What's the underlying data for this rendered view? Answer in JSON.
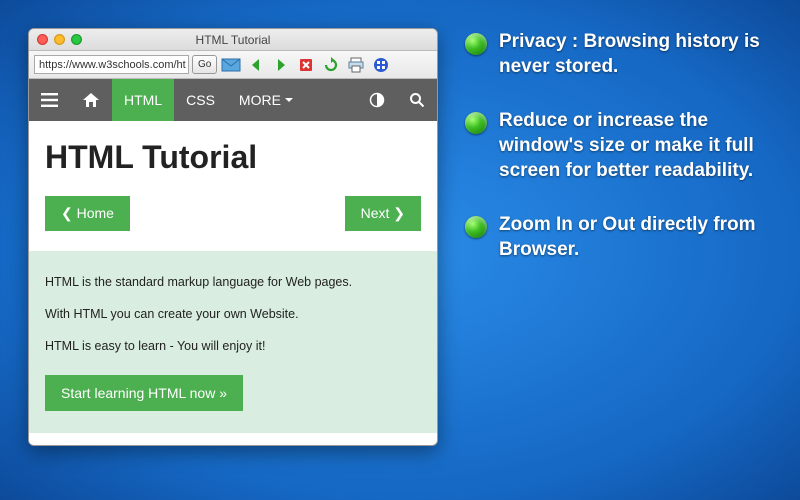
{
  "window": {
    "title": "HTML Tutorial",
    "url": "https://www.w3schools.com/ht",
    "go_label": "Go"
  },
  "site": {
    "nav": {
      "home": "",
      "html": "HTML",
      "css": "CSS",
      "more": "MORE"
    },
    "heading": "HTML Tutorial",
    "home_btn": "❮ Home",
    "next_btn": "Next ❯",
    "intro": {
      "p1": "HTML is the standard markup language for Web pages.",
      "p2": "With HTML you can create your own Website.",
      "p3": "HTML is easy to learn - You will enjoy it!"
    },
    "start_btn": "Start learning HTML now »"
  },
  "features": [
    "Privacy : Browsing history is never stored.",
    "Reduce or increase the window's size or make it full screen for better readability.",
    "Zoom In or Out directly from Browser."
  ]
}
